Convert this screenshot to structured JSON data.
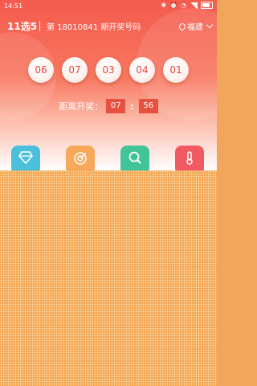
{
  "status_bar": {
    "time": "14:51"
  },
  "header": {
    "title": "11选5",
    "subtitle": "第 18010841 期开奖号码",
    "location": "福建"
  },
  "balls": [
    "06",
    "07",
    "03",
    "04",
    "01"
  ],
  "countdown": {
    "label": "距离开奖：",
    "minutes": "07",
    "seconds": "56",
    "separator": ":"
  },
  "menu": [
    {
      "icon": "diamond-icon",
      "color": "#4cc0da"
    },
    {
      "icon": "target-icon",
      "color": "#f7a858"
    },
    {
      "icon": "search-icon",
      "color": "#42c49a"
    },
    {
      "icon": "thermometer-icon",
      "color": "#f15a60"
    }
  ]
}
